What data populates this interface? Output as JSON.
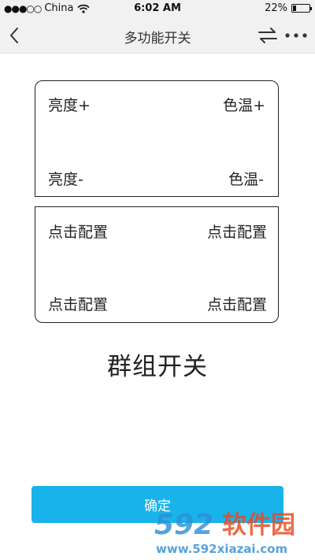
{
  "status_bar": {
    "signal": "●●●○○",
    "carrier": "China",
    "time": "6:02 AM",
    "battery_text": "22%",
    "battery_level": 0.22
  },
  "nav": {
    "title": "多功能开关",
    "back_icon": "chevron-left-icon",
    "swap_icon": "swap-arrows-icon",
    "more_icon": "more-dots-icon"
  },
  "switch_card_top": {
    "top_left": "亮度+",
    "top_right": "色温+",
    "bottom_left": "亮度-",
    "bottom_right": "色温-"
  },
  "switch_card_bottom": {
    "top_left": "点击配置",
    "top_right": "点击配置",
    "bottom_left": "点击配置",
    "bottom_right": "点击配置"
  },
  "group_title": "群组开关",
  "confirm_label": "确定",
  "watermark": {
    "brand": "592软件园",
    "url": "www.592xiazai.com"
  },
  "colors": {
    "bars": "#f1f1f1",
    "accent": "#19b3ec",
    "watermark_number": "#2f8fd6",
    "watermark_text": "#e94a1f"
  }
}
